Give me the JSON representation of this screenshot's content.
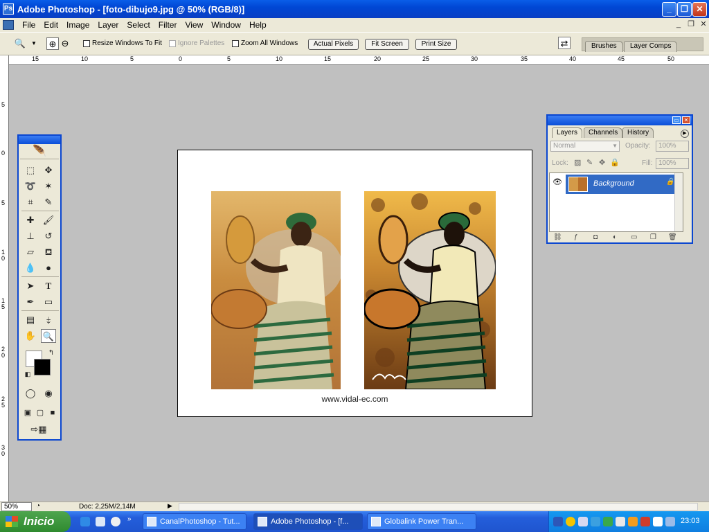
{
  "window": {
    "title": "Adobe Photoshop - [foto-dibujo9.jpg @ 50% (RGB/8)]",
    "min": "_",
    "max": "❐",
    "close": "✕"
  },
  "menu": {
    "items": [
      "File",
      "Edit",
      "Image",
      "Layer",
      "Select",
      "Filter",
      "View",
      "Window",
      "Help"
    ]
  },
  "options": {
    "resize_windows": "Resize Windows To Fit",
    "ignore_palettes": "Ignore Palettes",
    "zoom_all": "Zoom All Windows",
    "actual_pixels": "Actual Pixels",
    "fit_screen": "Fit Screen",
    "print_size": "Print Size",
    "wells": [
      "Brushes",
      "Layer Comps"
    ]
  },
  "ruler": {
    "h_labels": [
      "15",
      "10",
      "5",
      "0",
      "5",
      "10",
      "15",
      "20",
      "25",
      "30",
      "35",
      "40",
      "45",
      "50"
    ],
    "v_labels": [
      "5",
      "0",
      "5",
      "1\n0",
      "1\n5",
      "2\n0",
      "2\n5",
      "3\n0"
    ]
  },
  "document": {
    "caption": "www.vidal-ec.com"
  },
  "layers_panel": {
    "tabs": [
      "Layers",
      "Channels",
      "History"
    ],
    "blend_mode": "Normal",
    "opacity_label": "Opacity:",
    "opacity_value": "100%",
    "lock_label": "Lock:",
    "fill_label": "Fill:",
    "fill_value": "100%",
    "layer_name": "Background"
  },
  "status": {
    "zoom": "50%",
    "doc": "Doc: 2,25M/2,14M"
  },
  "taskbar": {
    "start": "Inicio",
    "tasks": [
      "CanalPhotoshop - Tut...",
      "Adobe Photoshop - [f...",
      "Globalink Power Tran..."
    ],
    "clock": "23:03"
  },
  "colors": {
    "title_blue": "#0a5de8",
    "chrome": "#ece9d8",
    "taskbar": "#245edb",
    "start_green": "#3c9a3c",
    "layer_selected": "#316ac5"
  }
}
